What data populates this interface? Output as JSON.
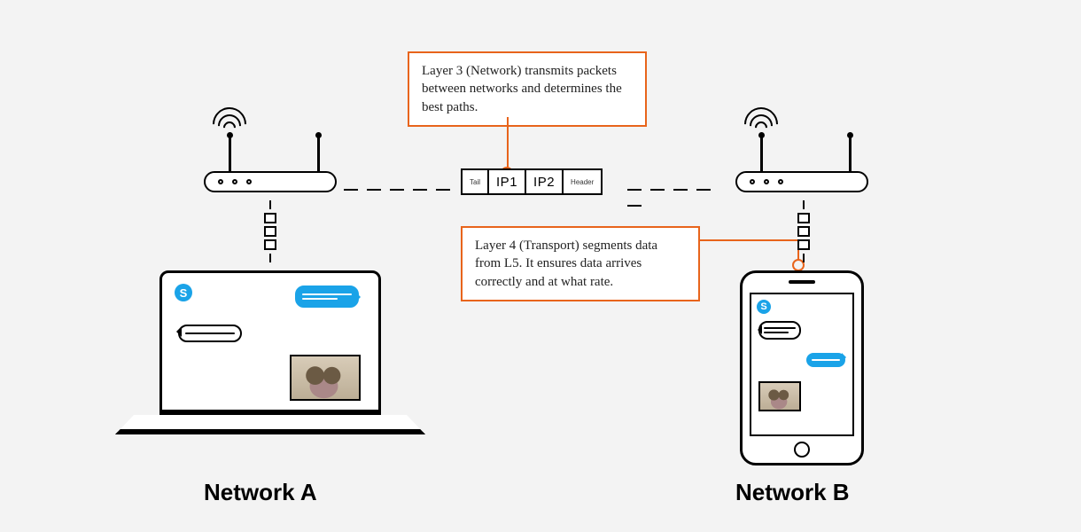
{
  "callouts": {
    "layer3": "Layer 3 (Network) transmits packets between networks and determines the best paths.",
    "layer4": "Layer 4 (Transport) segments data from L5. It ensures data arrives correctly and at what rate."
  },
  "packet": {
    "tail": "Tail",
    "ip1": "IP1",
    "ip2": "IP2",
    "header": "Header"
  },
  "labels": {
    "network_a": "Network A",
    "network_b": "Network B"
  },
  "icons": {
    "skype_glyph": "S"
  }
}
